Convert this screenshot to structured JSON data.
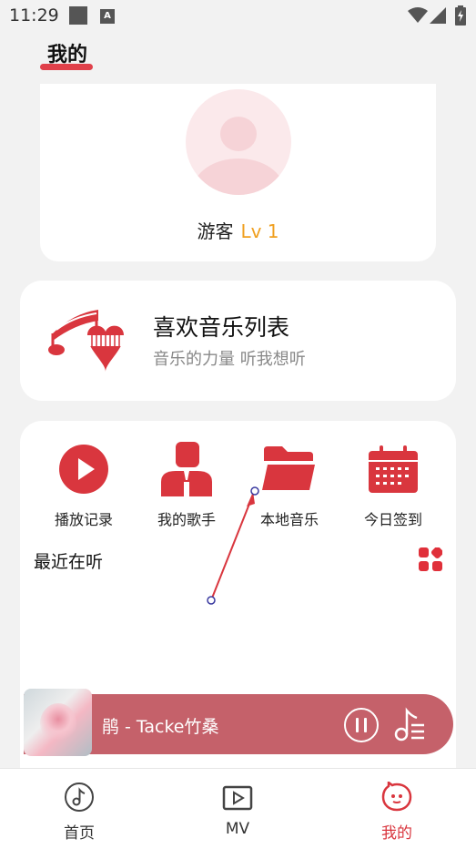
{
  "status_bar": {
    "time": "11:29",
    "notification_glyph": "A"
  },
  "header": {
    "title": "我的"
  },
  "profile": {
    "username": "游客",
    "level": "Lv 1"
  },
  "favorites": {
    "title": "喜欢音乐列表",
    "subtitle": "音乐的力量 听我想听"
  },
  "quick_actions": [
    {
      "label": "播放记录",
      "icon": "play-circle-icon"
    },
    {
      "label": "我的歌手",
      "icon": "singer-icon"
    },
    {
      "label": "本地音乐",
      "icon": "folder-icon"
    },
    {
      "label": "今日签到",
      "icon": "calendar-icon"
    }
  ],
  "recent": {
    "title": "最近在听"
  },
  "player": {
    "song": "鹃 - Tacke竹桑",
    "state": "playing"
  },
  "bottom_nav": [
    {
      "label": "首页",
      "icon": "music-note-icon"
    },
    {
      "label": "MV",
      "icon": "video-play-icon"
    },
    {
      "label": "我的",
      "icon": "mine-face-icon",
      "active": true
    }
  ],
  "colors": {
    "accent": "#d9363e",
    "player_bg": "#c5616a",
    "level": "#f0a020"
  }
}
